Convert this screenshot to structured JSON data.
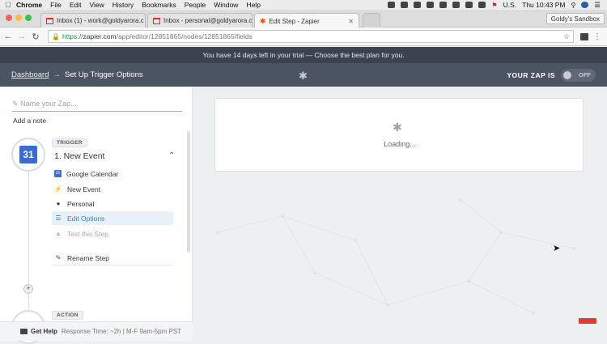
{
  "menubar": {
    "apple": "",
    "items": [
      "Chrome",
      "File",
      "Edit",
      "View",
      "History",
      "Bookmarks",
      "People",
      "Window",
      "Help"
    ],
    "locale": "U.S.",
    "clock": "Thu 10:43 PM"
  },
  "tabs": [
    {
      "title": "Inbox (1) - work@goldyarora.c",
      "active": false
    },
    {
      "title": "Inbox - personal@goldyarora.c",
      "active": false
    },
    {
      "title": "Edit Step - Zapier",
      "active": true
    }
  ],
  "profile": "Goldy's Sandbox",
  "address": {
    "scheme": "https://",
    "host": "zapier.com",
    "path": "/app/editor/12851865/nodes/12851865/fields"
  },
  "banner": "You have 14 days left in your trial — Choose the best plan for you.",
  "header": {
    "breadcrumb_link": "Dashboard",
    "breadcrumb_sep": "→",
    "breadcrumb_current": "Set Up Trigger Options",
    "zap_status_label": "YOUR ZAP IS",
    "toggle_label": "OFF"
  },
  "left": {
    "zap_name_placeholder": "Name your Zap...",
    "add_note": "Add a note",
    "trigger_badge": "TRIGGER",
    "trigger_icon_text": "31",
    "step_title": "1. New Event",
    "steps": [
      {
        "label": "Google Calendar",
        "icon": "calendar-icon"
      },
      {
        "label": "New Event",
        "icon": "bolt-icon"
      },
      {
        "label": "Personal",
        "icon": "person-icon"
      },
      {
        "label": "Edit Options",
        "icon": "list-icon"
      },
      {
        "label": "Test this Step",
        "icon": "flask-icon"
      }
    ],
    "rename": "Rename Step",
    "action_badge": "ACTION"
  },
  "help": {
    "label": "Get Help",
    "response": "Response Time: ~2h | M-F 9am-5pm PST"
  },
  "main": {
    "loading": "Loading..."
  }
}
